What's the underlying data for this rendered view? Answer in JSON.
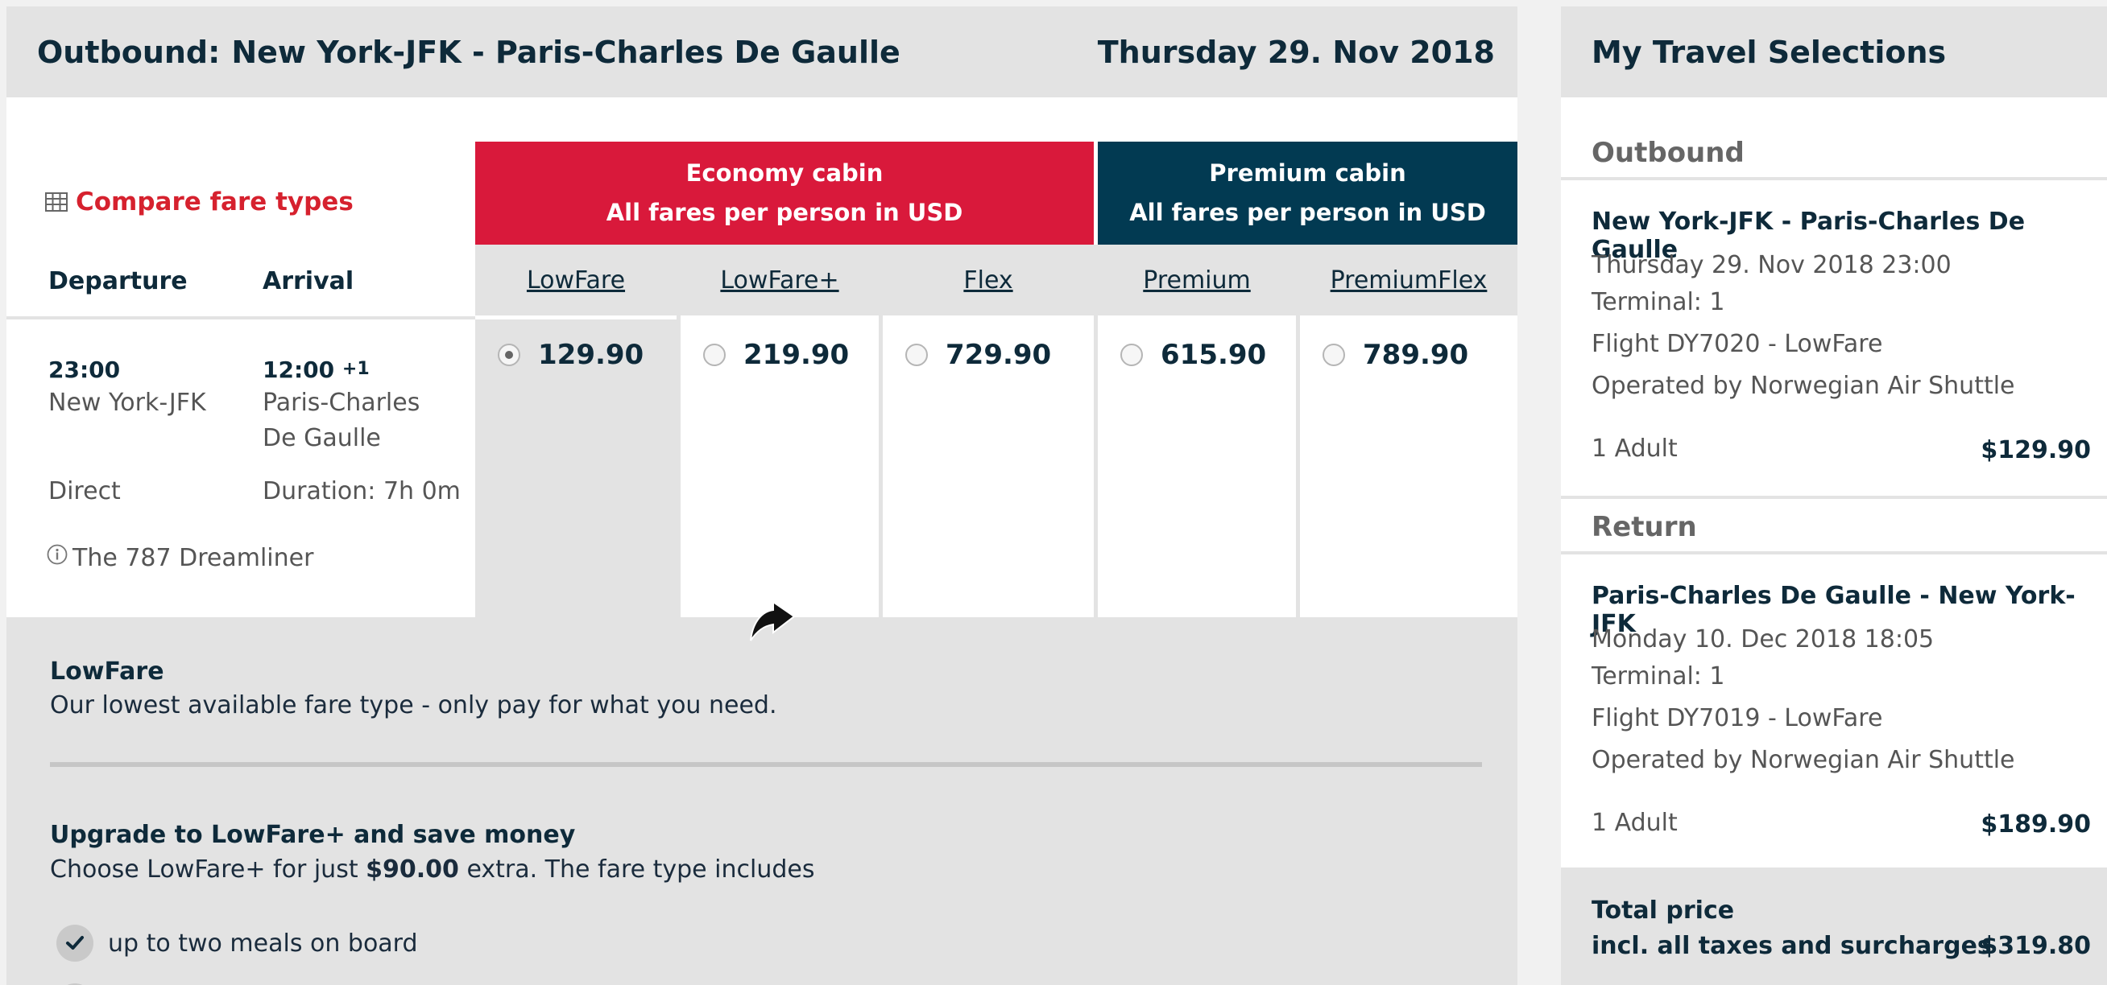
{
  "outbound": {
    "label": "Outbound:",
    "route": "New York-JFK - Paris-Charles De Gaulle",
    "date": "Thursday 29. Nov 2018"
  },
  "compare": {
    "label": "Compare fare types",
    "icon": "table-grid-icon"
  },
  "flight": {
    "departure_header": "Departure",
    "arrival_header": "Arrival",
    "dep_time": "23:00",
    "dep_place": "New York-JFK",
    "arr_time": "12:00",
    "arr_day_offset": "+1",
    "arr_place_line1": "Paris-Charles",
    "arr_place_line2": "De Gaulle",
    "stops": "Direct",
    "duration": "Duration: 7h 0m",
    "aircraft": "The 787 Dreamliner"
  },
  "cabins": {
    "economy": {
      "line1": "Economy cabin",
      "line2": "All fares per person in USD",
      "color": "#d9193b"
    },
    "premium": {
      "line1": "Premium cabin",
      "line2": "All fares per person in USD",
      "color": "#023a52"
    }
  },
  "fares": [
    {
      "name": "LowFare",
      "price": "129.90",
      "selected": true
    },
    {
      "name": "LowFare+",
      "price": "219.90",
      "selected": false
    },
    {
      "name": "Flex",
      "price": "729.90",
      "selected": false
    },
    {
      "name": "Premium",
      "price": "615.90",
      "selected": false
    },
    {
      "name": "PremiumFlex",
      "price": "789.90",
      "selected": false
    }
  ],
  "details": {
    "title": "LowFare",
    "description": "Our lowest available fare type - only pay for what you need.",
    "upgrade_title": "Upgrade to LowFare+ and save money",
    "upgrade_prefix": "Choose LowFare+ for just ",
    "upgrade_amount": "$90.00",
    "upgrade_suffix": " extra. The fare type includes",
    "benefits": [
      "up to two meals on board"
    ]
  },
  "selections": {
    "title": "My Travel Selections",
    "outbound": {
      "section": "Outbound",
      "route": "New York-JFK - Paris-Charles De Gaulle",
      "datetime": "Thursday 29. Nov 2018 23:00",
      "terminal": "Terminal: 1",
      "flight": "Flight DY7020 - LowFare",
      "operator": "Operated by Norwegian Air Shuttle",
      "pax": "1 Adult",
      "amount": "$129.90"
    },
    "return": {
      "section": "Return",
      "route": "Paris-Charles De Gaulle - New York-JFK",
      "datetime": "Monday 10. Dec 2018 18:05",
      "terminal": "Terminal: 1",
      "flight": "Flight DY7019 - LowFare",
      "operator": "Operated by Norwegian Air Shuttle",
      "pax": "1 Adult",
      "amount": "$189.90"
    },
    "total": {
      "line1": "Total price",
      "line2": "incl. all taxes and surcharges",
      "amount": "$319.80"
    }
  }
}
